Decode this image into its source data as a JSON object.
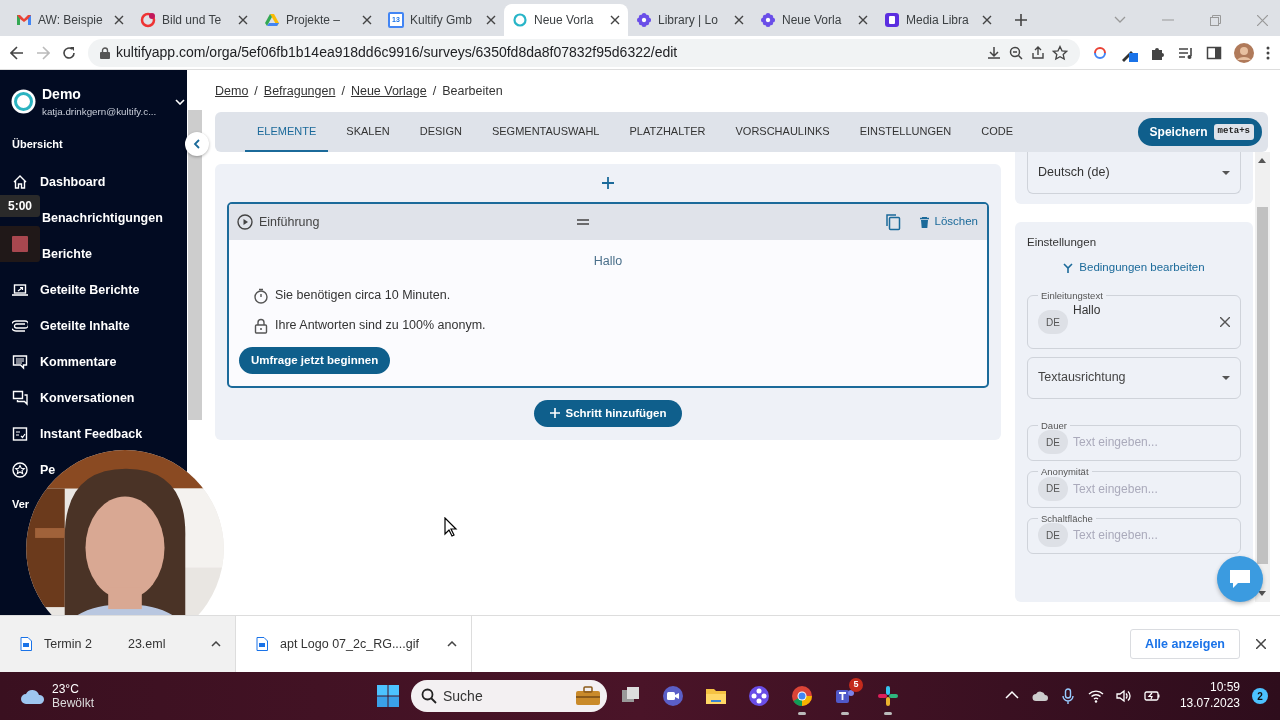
{
  "browser": {
    "tabs": [
      {
        "kind": "mail",
        "title": "AW: Beispie",
        "selected": false
      },
      {
        "kind": "dots",
        "title": "Bild und Te",
        "selected": false
      },
      {
        "kind": "drive",
        "title": "Projekte –",
        "selected": false
      },
      {
        "kind": "calendar",
        "icon_text": "13",
        "title": "Kultify Gmb",
        "selected": false
      },
      {
        "kind": "ring",
        "title": "Neue Vorla",
        "selected": true
      },
      {
        "kind": "flower",
        "title": "Library | Lo",
        "selected": false
      },
      {
        "kind": "flower",
        "title": "Neue Vorla",
        "selected": false
      },
      {
        "kind": "square",
        "title": "Media Libra",
        "selected": false
      }
    ],
    "url": "kultifyapp.com/orga/5ef06fb1b14ea918dd6c9916/surveys/6350fd8da8f07832f95d6322/edit"
  },
  "sidebar": {
    "org": "Demo",
    "email": "katja.drinkgern@kultify.c...",
    "section": "Übersicht",
    "items": [
      {
        "kind": "home",
        "label": "Dashboard"
      },
      {
        "kind": "hidden",
        "label": "Benachrichtigungen"
      },
      {
        "kind": "hidden",
        "label": "Berichte"
      },
      {
        "kind": "laptop",
        "label": "Geteilte Berichte"
      },
      {
        "kind": "clip",
        "label": "Geteilte Inhalte"
      },
      {
        "kind": "comment",
        "label": "Kommentare"
      },
      {
        "kind": "chat",
        "label": "Konversationen"
      },
      {
        "kind": "checklist",
        "label": "Instant Feedback"
      },
      {
        "kind": "starcircle",
        "label": "Pe"
      }
    ],
    "footer_section": "Ver"
  },
  "recorder": {
    "timer": "5:00"
  },
  "breadcrumb_separator": "/",
  "breadcrumbs": [
    {
      "label": "Demo",
      "link": true
    },
    {
      "label": "Befragungen",
      "link": true
    },
    {
      "label": "Neue Vorlage",
      "link": true
    },
    {
      "label": "Bearbeiten",
      "link": false
    }
  ],
  "nav_tabs": [
    {
      "label": "ELEMENTE",
      "selected": true
    },
    {
      "label": "SKALEN",
      "selected": false
    },
    {
      "label": "DESIGN",
      "selected": false
    },
    {
      "label": "SEGMENTAUSWAHL",
      "selected": false
    },
    {
      "label": "PLATZHALTER",
      "selected": false
    },
    {
      "label": "VORSCHAULINKS",
      "selected": false
    },
    {
      "label": "EINSTELLUNGEN",
      "selected": false
    },
    {
      "label": "CODE",
      "selected": false
    }
  ],
  "save_button": {
    "label": "Speichern",
    "shortcut": "meta+s"
  },
  "step": {
    "title": "Einführung",
    "delete": "Löschen",
    "greeting": "Hallo",
    "lines": [
      {
        "kind": "timer",
        "text": "Sie benötigen circa 10 Minuten."
      },
      {
        "kind": "lock",
        "text": "Ihre Antworten sind zu 100% anonym."
      }
    ],
    "start_button": "Umfrage jetzt beginnen"
  },
  "add_step": "Schritt hinzufügen",
  "settings": {
    "language": "Deutsch (de)",
    "title": "Einstellungen",
    "conditions_link": "Bedingungen bearbeiten",
    "fields": [
      {
        "kind": "text",
        "label": "Einleitungstext",
        "lang": "DE",
        "value": "Hallo"
      },
      {
        "kind": "select",
        "placeholder": "Textausrichtung"
      },
      {
        "kind": "text",
        "label": "Dauer",
        "lang": "DE",
        "placeholder": "Text eingeben..."
      },
      {
        "kind": "text",
        "label": "Anonymität",
        "lang": "DE",
        "placeholder": "Text eingeben..."
      },
      {
        "kind": "text",
        "label": "Schaltfläche",
        "lang": "DE",
        "placeholder": "Text eingeben..."
      }
    ]
  },
  "downloads": {
    "items": [
      {
        "name": "Termin 2",
        "name_end": "23.eml",
        "hovered": true
      },
      {
        "name": "apt Logo 07_2c_RG....gif",
        "hovered": false
      }
    ],
    "show_all": "Alle anzeigen"
  },
  "taskbar": {
    "temperature": "23°C",
    "condition": "Bewölkt",
    "search": "Suche",
    "apps": [
      {
        "kind": "taskview",
        "running": false
      },
      {
        "kind": "meet",
        "running": false
      },
      {
        "kind": "folder",
        "running": false
      },
      {
        "kind": "flower",
        "running": false
      },
      {
        "kind": "chrome",
        "running": true
      },
      {
        "kind": "teams",
        "running": true,
        "badge": "5"
      },
      {
        "kind": "slack",
        "running": true
      }
    ],
    "time": "10:59",
    "date": "13.07.2023",
    "notifications": "2"
  }
}
